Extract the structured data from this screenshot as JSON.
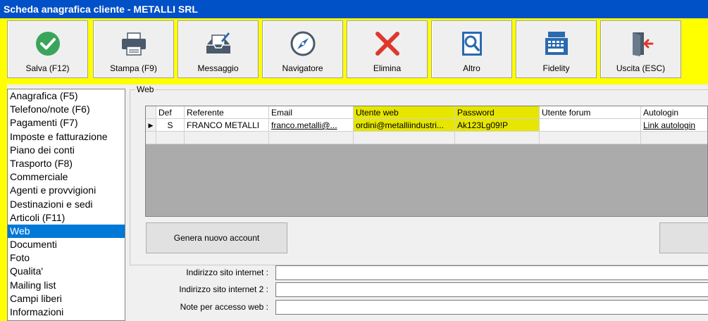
{
  "window": {
    "title": "Scheda anagrafica cliente - METALLI SRL"
  },
  "toolbar": {
    "buttons": [
      {
        "label": "Salva (F12)",
        "icon": "check-circle-icon"
      },
      {
        "label": "Stampa (F9)",
        "icon": "printer-icon"
      },
      {
        "label": "Messaggio",
        "icon": "message-edit-icon"
      },
      {
        "label": "Navigatore",
        "icon": "compass-icon"
      },
      {
        "label": "Elimina",
        "icon": "delete-x-icon"
      },
      {
        "label": "Altro",
        "icon": "search-book-icon"
      },
      {
        "label": "Fidelity",
        "icon": "cash-register-icon"
      },
      {
        "label": "Uscita (ESC)",
        "icon": "exit-door-icon"
      }
    ]
  },
  "sidebar": {
    "items": [
      "Anagrafica (F5)",
      "Telefono/note (F6)",
      "Pagamenti (F7)",
      "Imposte e fatturazione",
      "Piano dei conti",
      "Trasporto (F8)",
      "Commerciale",
      "Agenti e provvigioni",
      "Destinazioni e sedi",
      "Articoli (F11)",
      "Web",
      "Documenti",
      "Foto",
      "Qualita'",
      "Mailing list",
      "Campi liberi",
      "Informazioni"
    ],
    "selected": "Web"
  },
  "web": {
    "group_title": "Web",
    "grid": {
      "columns": [
        "Def",
        "Referente",
        "Email",
        "Utente web",
        "Password",
        "Utente forum",
        "Autologin"
      ],
      "rows": [
        {
          "Def": "S",
          "Referente": "FRANCO METALLI",
          "Email": "franco.metalli@...",
          "Utente web": "ordini@metalliindustri...",
          "Password": "Ak123Lg09!P",
          "Utente forum": "",
          "Autologin": "Link autologin"
        }
      ],
      "row_marker": "▶"
    },
    "generate_button": "Genera nuovo account",
    "fields": [
      {
        "label": "Indirizzo sito internet :",
        "value": ""
      },
      {
        "label": "Indirizzo sito internet 2 :",
        "value": ""
      },
      {
        "label": "Note per accesso web :",
        "value": ""
      }
    ]
  },
  "colors": {
    "titlebar": "#0050c8",
    "frame": "#ffff00",
    "highlight_column": "#e6e600",
    "selection": "#0078d7"
  }
}
